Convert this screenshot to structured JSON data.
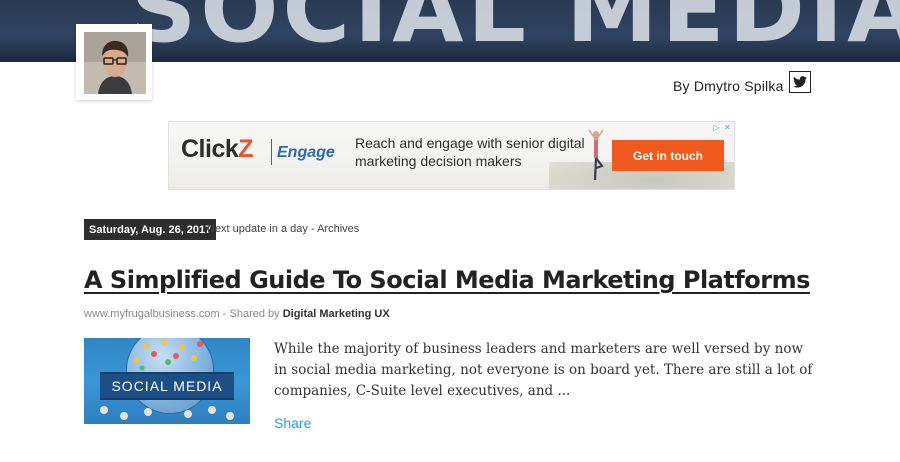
{
  "hero": {
    "text": "SOCIAL MEDIA"
  },
  "author": {
    "byline": "By Dmytro Spilka"
  },
  "ad": {
    "logo_click": "Click",
    "logo_z": "Z",
    "logo_engage": "Engage",
    "copy": "Reach and engage with senior digital marketing decision makers",
    "cta": "Get in touch",
    "cta_color": "#f05a1e"
  },
  "post": {
    "date": "Saturday, Aug. 26, 2017",
    "update_meta": "Next update in a day - Archives",
    "title": "A Simplified Guide To Social Media Marketing Platforms",
    "source_domain": "www.myfrugalbusiness.com",
    "shared_by_prefix": " - Shared by ",
    "shared_by": "Digital Marketing UX",
    "thumbnail_text": "SOCIAL MEDIA",
    "excerpt": "While the majority of business leaders and marketers are well versed by now in social media marketing, not everyone is on board yet. There are still a lot of companies, C-Suite level executives, and ...",
    "share_label": "Share"
  }
}
